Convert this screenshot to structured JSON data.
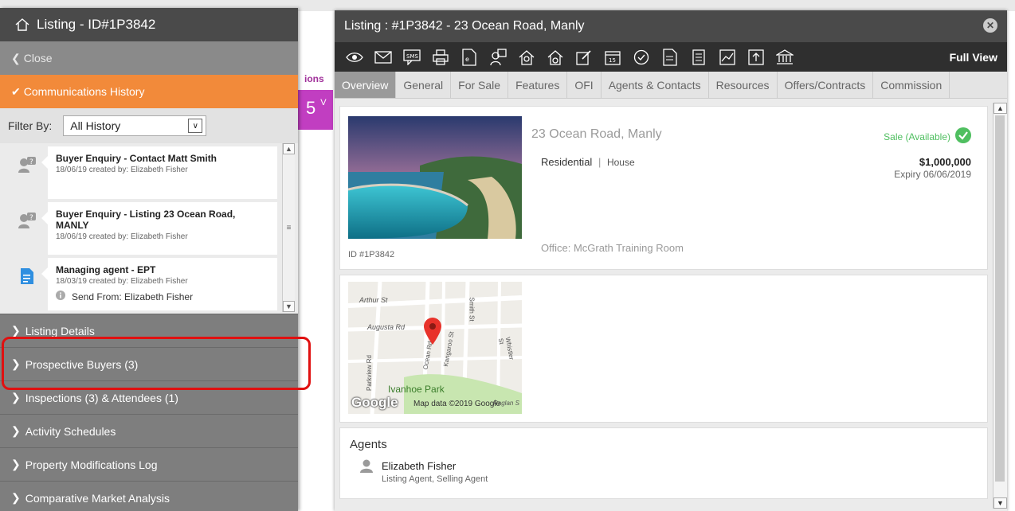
{
  "left_panel": {
    "title": "Listing - ID#1P3842",
    "close_label": "Close",
    "comm_history_label": "Communications History",
    "filter": {
      "label": "Filter By:",
      "value": "All History"
    },
    "history": [
      {
        "title": "Buyer Enquiry - Contact Matt Smith",
        "meta": "18/06/19 created by: Elizabeth Fisher",
        "icon": "buyer-enquiry-icon"
      },
      {
        "title": "Buyer Enquiry - Listing 23 Ocean Road,",
        "title2": "MANLY",
        "meta": "18/06/19 created by: Elizabeth Fisher",
        "icon": "buyer-enquiry-icon"
      },
      {
        "title": "Managing agent - EPT",
        "meta": "18/03/19 created by: Elizabeth Fisher",
        "send_from": "Send From: Elizabeth Fisher",
        "icon": "document-icon"
      }
    ],
    "sections": [
      "Listing Details",
      "Prospective Buyers (3)",
      "Inspections (3) & Attendees (1)",
      "Activity Schedules",
      "Property Modifications Log",
      "Comparative Market Analysis"
    ]
  },
  "background": {
    "fragment_ions": "ions",
    "fragment_5": "5",
    "fragment_v": "V"
  },
  "modal": {
    "title": "Listing : #1P3842 - 23 Ocean Road, Manly",
    "full_view": "Full View",
    "tabs": [
      "Overview",
      "General",
      "For Sale",
      "Features",
      "OFI",
      "Agents & Contacts",
      "Resources",
      "Offers/Contracts",
      "Commission"
    ],
    "active_tab": "Overview",
    "overview": {
      "address": "23 Ocean Road, Manly",
      "type": "Residential",
      "subtype": "House",
      "separator": "|",
      "status": "Sale (Available)",
      "price": "$1,000,000",
      "expiry": "Expiry 06/06/2019",
      "office": "Office: McGrath Training Room",
      "listing_id": "ID #1P3842"
    },
    "map": {
      "streets": [
        "Arthur St",
        "Augusta Rd",
        "Smith St",
        "Ocean Rd",
        "Kangaroo St",
        "Whistler St",
        "Parkview Rd",
        "Raglan S"
      ],
      "park": "Ivanhoe Park",
      "logo": "Google",
      "credit": "Map data ©2019 Google"
    },
    "agents": {
      "heading": "Agents",
      "name": "Elizabeth Fisher",
      "role": "Listing Agent, Selling Agent"
    }
  },
  "colors": {
    "accent_orange": "#f28a3a",
    "status_green": "#4fbf60",
    "highlight_red": "#e01010",
    "header_dark": "#4a4a4a"
  }
}
